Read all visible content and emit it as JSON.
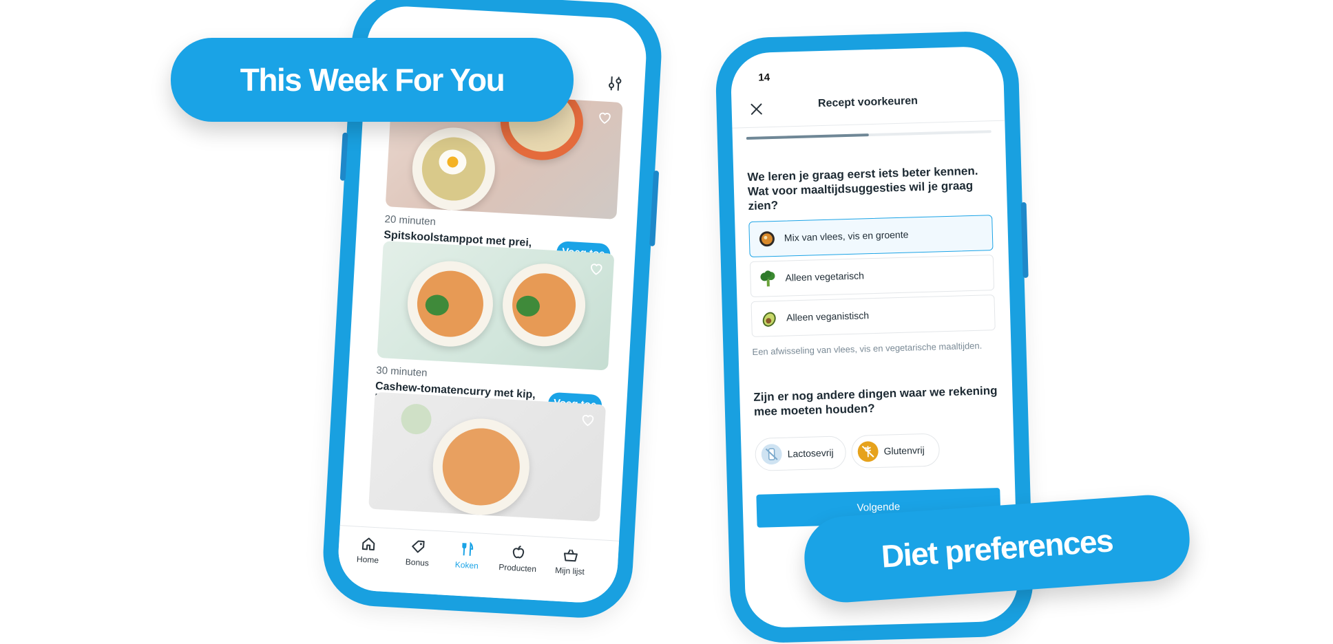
{
  "left_screen": {
    "recipes": [
      {
        "minutes": "20 minuten",
        "title": "Spitskoolstamppot met prei, spek en gebakken ei",
        "add_label": "Voeg toe"
      },
      {
        "minutes": "30 minuten",
        "title": "Cashew-tomatencurry met kip, broccoli en zilvervliesrijst",
        "add_label": "Voeg toe"
      }
    ],
    "tabs": [
      {
        "label": "Home",
        "icon": "home-icon"
      },
      {
        "label": "Bonus",
        "icon": "tag-icon"
      },
      {
        "label": "Koken",
        "icon": "cutlery-icon",
        "active": true
      },
      {
        "label": "Producten",
        "icon": "apple-icon"
      },
      {
        "label": "Mijn lijst",
        "icon": "basket-icon"
      }
    ]
  },
  "right_screen": {
    "status_time": "14",
    "title": "Recept voorkeuren",
    "progress_fraction": 0.5,
    "question1": "We leren je graag eerst iets beter kennen. Wat voor maaltijdsuggesties wil je graag zien?",
    "options": [
      {
        "label": "Mix van vlees, vis en groente",
        "icon": "pan-icon",
        "selected": true
      },
      {
        "label": "Alleen vegetarisch",
        "icon": "broccoli-icon",
        "selected": false
      },
      {
        "label": "Alleen veganistisch",
        "icon": "avocado-icon",
        "selected": false
      }
    ],
    "helper": "Een afwisseling van vlees, vis en vegetarische maaltijden.",
    "question2": "Zijn er nog andere dingen waar we rekening mee moeten houden?",
    "chips": [
      {
        "label": "Lactosevrij",
        "icon": "no-milk-icon"
      },
      {
        "label": "Glutenvrij",
        "icon": "no-gluten-icon"
      }
    ],
    "next_label": "Volgende"
  },
  "bubbles": {
    "left": "This Week For You",
    "right": "Diet preferences"
  },
  "colors": {
    "brand_blue": "#1aa3e6",
    "phone_frame": "#19a0e0"
  }
}
